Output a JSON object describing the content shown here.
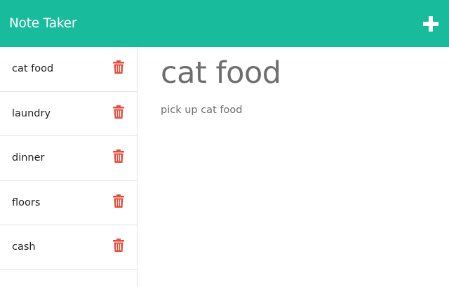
{
  "app": {
    "brand": "Note Taker",
    "add_icon": "plus-icon"
  },
  "colors": {
    "navbar": "#18bc9c",
    "trash": "#e74c3c",
    "title_text": "#6e6e6e"
  },
  "notes": [
    {
      "title": "cat food",
      "delete_icon": "trash-icon"
    },
    {
      "title": "laundry",
      "delete_icon": "trash-icon"
    },
    {
      "title": "dinner",
      "delete_icon": "trash-icon"
    },
    {
      "title": "floors",
      "delete_icon": "trash-icon"
    },
    {
      "title": "cash",
      "delete_icon": "trash-icon"
    }
  ],
  "active_note": {
    "title": "cat food",
    "text": "pick up cat food"
  }
}
